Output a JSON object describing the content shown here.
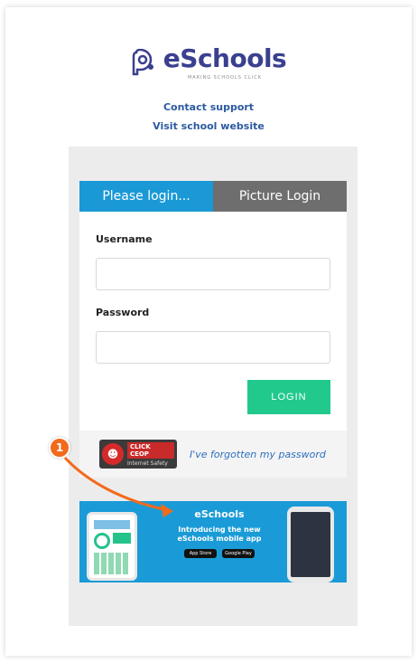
{
  "brand": {
    "name": "eSchools",
    "tagline": "MAKING SCHOOLS CLICK"
  },
  "links": {
    "contact": "Contact support",
    "visit": "Visit school website"
  },
  "tabs": [
    {
      "label": "Please login...",
      "active": true
    },
    {
      "label": "Picture Login",
      "active": false
    }
  ],
  "form": {
    "username_label": "Username",
    "username_value": "",
    "password_label": "Password",
    "password_value": "",
    "login_label": "LOGIN"
  },
  "footer": {
    "ceop_title": "CLICK CEOP",
    "ceop_sub": "Internet Safety",
    "forgot": "I've forgotten my password"
  },
  "banner": {
    "brand": "eSchools",
    "line1": "Introducing the new",
    "line2": "eSchools mobile app",
    "store1": "App Store",
    "store2": "Google Play"
  },
  "annotation": {
    "number": "1"
  },
  "colors": {
    "brand": "#3a3f8f",
    "link": "#2c5aa0",
    "tab_active": "#1a99d6",
    "tab_inactive": "#6e6e6e",
    "login_button": "#21c98d",
    "banner": "#1a9bd7",
    "callout": "#f26a1b"
  }
}
